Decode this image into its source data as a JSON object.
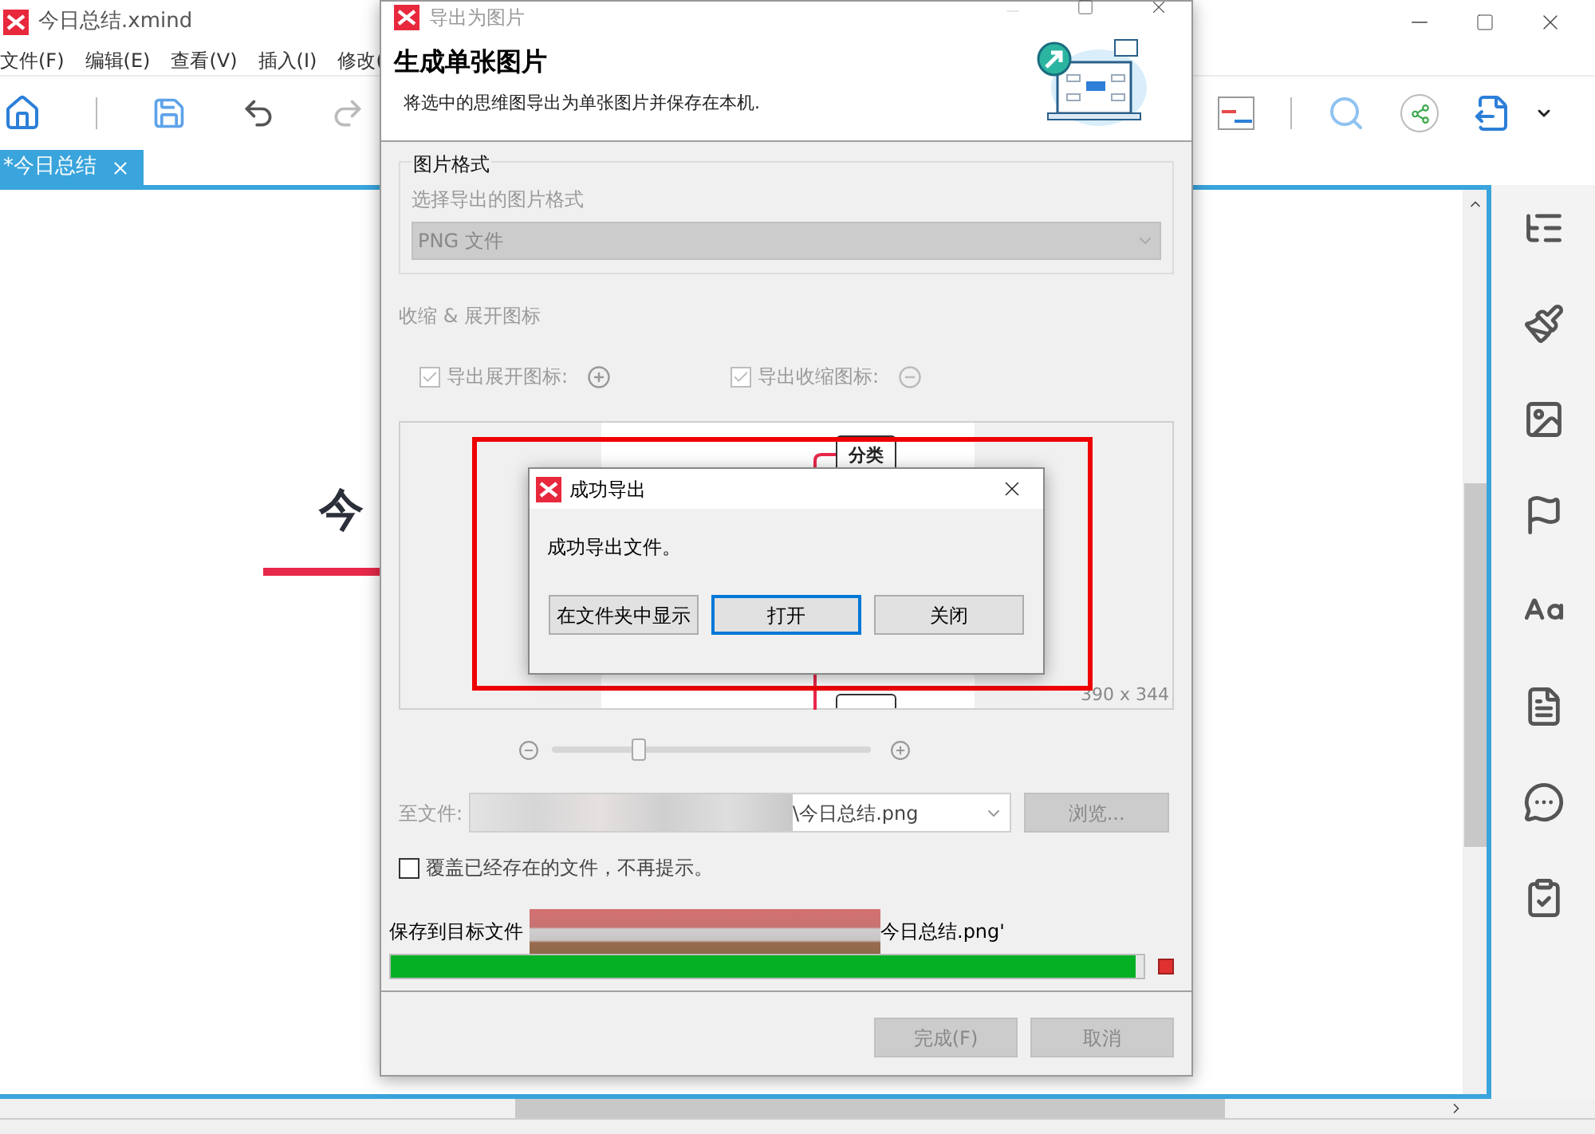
{
  "app": {
    "title": "今日总结.xmind",
    "menu": [
      "文件(F)",
      "编辑(E)",
      "查看(V)",
      "插入(I)",
      "修改("
    ],
    "tab": {
      "label": "*今日总结",
      "selected": true
    },
    "topic": "今"
  },
  "export_dialog": {
    "title": "导出为图片",
    "heading": "生成单张图片",
    "subtitle": "将选中的思维图导出为单张图片并保存在本机.",
    "format_group": "图片格式",
    "format_label": "选择导出的图片格式",
    "format_value": "PNG 文件",
    "icons_section": "收缩 & 展开图标",
    "icon_options": [
      {
        "kind": "expand",
        "label": "导出展开图标:",
        "checked": true,
        "disabled": true
      },
      {
        "kind": "collapse",
        "label": "导出收缩图标:",
        "checked": true,
        "disabled": true
      }
    ],
    "preview": {
      "node": "分类",
      "size": "390 x 344"
    },
    "zoom": {
      "level": 0.27
    },
    "file_label": "至文件:",
    "file_value": "\\今日总结.png",
    "browse": "浏览...",
    "overwrite": {
      "label": "覆盖已经存在的文件，不再提示。",
      "checked": false
    },
    "progress": {
      "label": "保存到目标文件",
      "target": "今日总结.png'",
      "level": 0.99
    },
    "buttons": [
      {
        "label": "完成(F)",
        "disabled": true
      },
      {
        "label": "取消",
        "disabled": true
      }
    ]
  },
  "success_dialog": {
    "title": "成功导出",
    "message": "成功导出文件。",
    "buttons": [
      {
        "label": "在文件夹中显示",
        "default": false
      },
      {
        "label": "打开",
        "default": true
      },
      {
        "label": "关闭",
        "default": false
      }
    ]
  }
}
